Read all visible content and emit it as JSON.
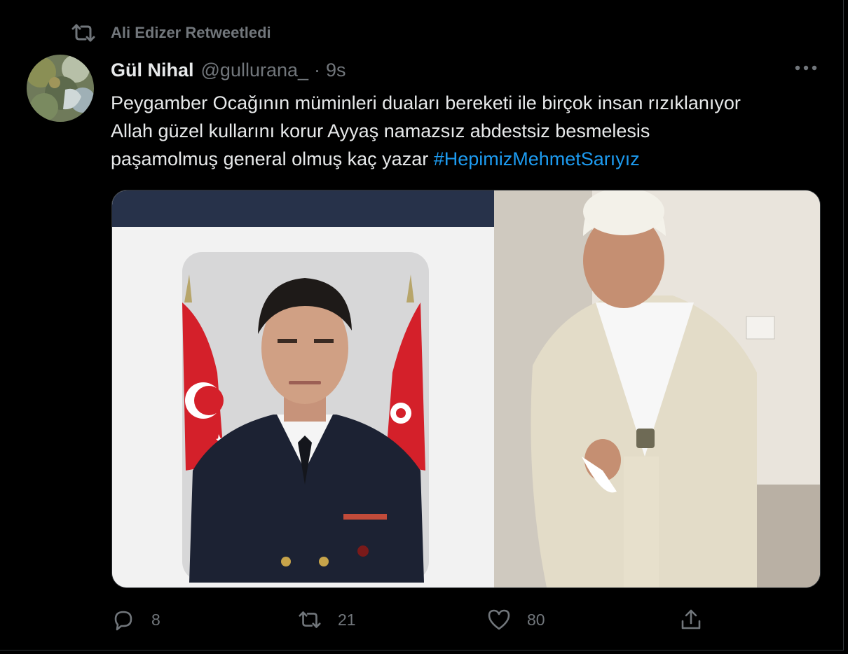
{
  "retweet": {
    "icon": "retweet-icon",
    "label": "Ali Edizer Retweetledi"
  },
  "tweet": {
    "author_name": "Gül Nihal",
    "handle": "@gullurana_",
    "separator": "·",
    "time": "9s",
    "more_icon": "more-icon",
    "text_lines": [
      "Peygamber Ocağının müminleri duaları bereketi ile birçok insan rızıklanıyor",
      "Allah güzel kullarını korur Ayyaş namazsız abdestsiz besmelesis",
      "paşamolmuş general olmuş kaç yazar "
    ],
    "hashtag": "#HepimizMehmetSarıyız"
  },
  "actions": {
    "reply": {
      "icon": "reply-icon",
      "count": "8"
    },
    "retweet": {
      "icon": "retweet-icon",
      "count": "21"
    },
    "like": {
      "icon": "heart-icon",
      "count": "80"
    },
    "share": {
      "icon": "share-icon"
    }
  },
  "colors": {
    "accent": "#1d9bf0",
    "muted": "#71767b",
    "text": "#e7e9ea",
    "background": "#000000"
  }
}
